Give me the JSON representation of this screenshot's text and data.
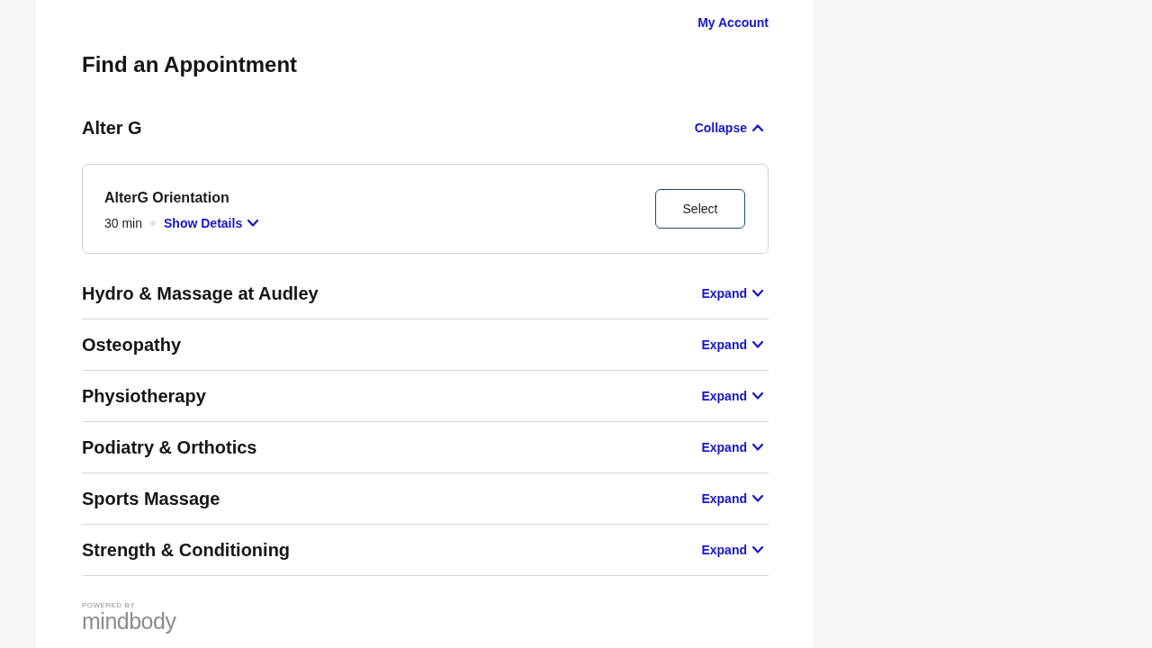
{
  "header": {
    "account_link": "My Account"
  },
  "title": "Find an Appointment",
  "categories": [
    {
      "name": "Alter G",
      "expanded": true,
      "toggle_label": "Collapse",
      "services": [
        {
          "name": "AlterG Orientation",
          "duration": "30 min",
          "details_link": "Show Details",
          "action": "Select"
        }
      ]
    },
    {
      "name": "Hydro & Massage at Audley",
      "expanded": false,
      "toggle_label": "Expand"
    },
    {
      "name": "Osteopathy",
      "expanded": false,
      "toggle_label": "Expand"
    },
    {
      "name": "Physiotherapy",
      "expanded": false,
      "toggle_label": "Expand"
    },
    {
      "name": "Podiatry & Orthotics",
      "expanded": false,
      "toggle_label": "Expand"
    },
    {
      "name": "Sports Massage",
      "expanded": false,
      "toggle_label": "Expand"
    },
    {
      "name": "Strength & Conditioning",
      "expanded": false,
      "toggle_label": "Expand"
    }
  ],
  "footer": {
    "powered_by": "POWERED BY",
    "brand": "mindbody"
  }
}
